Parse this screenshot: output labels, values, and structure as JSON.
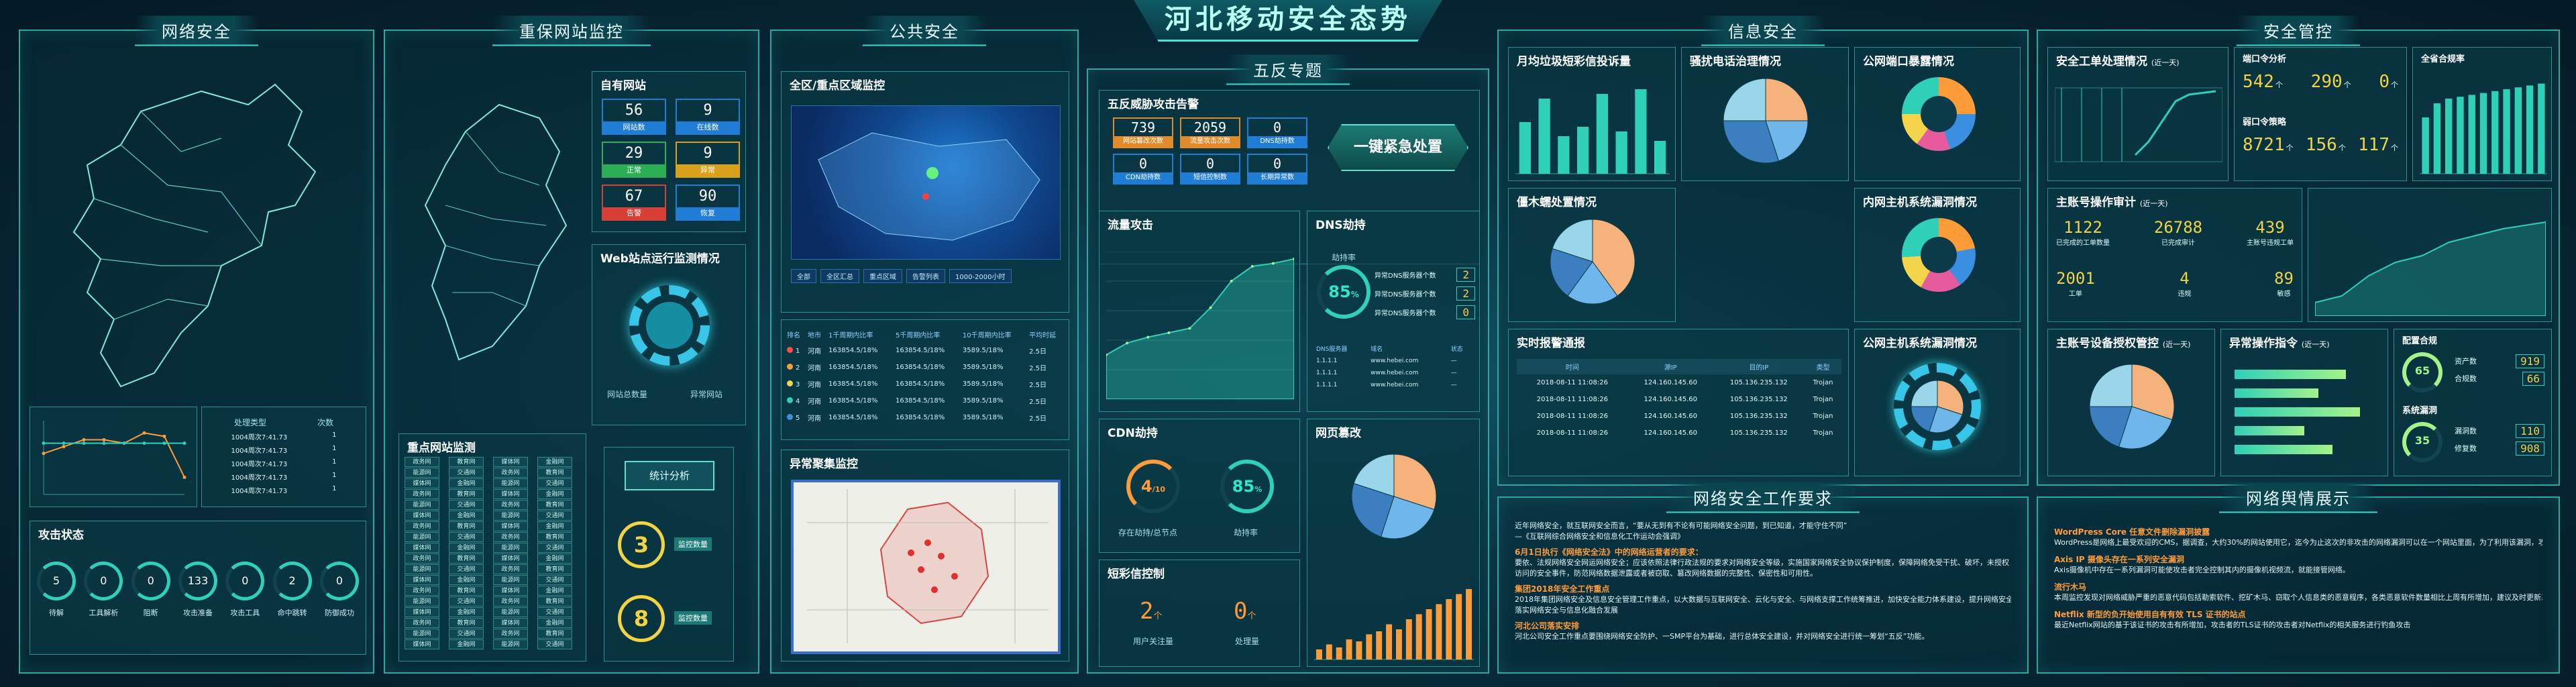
{
  "main_title": "河北移动安全态势",
  "sections": {
    "network_security": "网络安全",
    "key_sites": "重保网站监控",
    "public_security": "公共安全",
    "five_anti": "五反专题",
    "info_security": "信息安全",
    "security_control": "安全管控",
    "work_requirements": "网络安全工作要求",
    "intel_display": "网络舆情展示"
  },
  "attack_status": {
    "title": "攻击状态",
    "items": [
      {
        "value": "5",
        "label": "待解"
      },
      {
        "value": "0",
        "label": "工具解析"
      },
      {
        "value": "0",
        "label": "阻断"
      },
      {
        "value": "133",
        "label": "攻击准备"
      },
      {
        "value": "0",
        "label": "攻击工具"
      },
      {
        "value": "2",
        "label": "命中跳转"
      },
      {
        "value": "0",
        "label": "防御成功"
      }
    ]
  },
  "mini_table": {
    "headers": [
      "处理类型",
      "次数"
    ],
    "rows": [
      [
        "1004周次7:41.73",
        "1"
      ],
      [
        "1004周次7:41.73",
        "1"
      ],
      [
        "1004周次7:41.73",
        "1"
      ],
      [
        "1004周次7:41.73",
        "1"
      ],
      [
        "1004周次7:41.73",
        "1"
      ]
    ]
  },
  "own_sites": {
    "title": "自有网站",
    "cells": [
      {
        "value": "56",
        "label": "网站数",
        "color": "#1f7dd6"
      },
      {
        "value": "9",
        "label": "在线数",
        "color": "#1f7dd6"
      },
      {
        "value": "29",
        "label": "正常",
        "color": "#2cae55"
      },
      {
        "value": "9",
        "label": "异常",
        "color": "#d9a21a"
      },
      {
        "value": "67",
        "label": "告警",
        "color": "#d94035"
      },
      {
        "value": "90",
        "label": "恢复",
        "color": "#1f7dd6"
      }
    ]
  },
  "web_status": {
    "title": "Web站点运行监测情况",
    "labels": [
      "网站总数量",
      "异常网站"
    ]
  },
  "key_site_monitor": {
    "title": "重点网站监测",
    "buttons": [
      "政务网",
      "教育网",
      "媒体网",
      "金融网",
      "能源网",
      "交通网"
    ]
  },
  "side_counters": [
    {
      "value": "3",
      "label": "监控数量"
    },
    {
      "value": "8",
      "label": "监控数量"
    }
  ],
  "side_button": "统计分析",
  "region_monitor": {
    "title": "全区/重点区域监控"
  },
  "region_table": {
    "tabs": [
      "全部",
      "全区汇总",
      "重点区域",
      "告警列表",
      "1000-2000小时"
    ],
    "headers": [
      "排名",
      "地市",
      "1千周期内比率",
      "5千周期内比率",
      "10千周期内比率",
      "平均时延"
    ],
    "rows": [
      [
        "1",
        "河南",
        "163854.5/18%",
        "163854.5/18%",
        "3589.5/18%",
        "2.5日"
      ],
      [
        "2",
        "河南",
        "163854.5/18%",
        "163854.5/18%",
        "3589.5/18%",
        "2.5日"
      ],
      [
        "3",
        "河南",
        "163854.5/18%",
        "163854.5/18%",
        "3589.5/18%",
        "2.5日"
      ],
      [
        "4",
        "河南",
        "163854.5/18%",
        "163854.5/18%",
        "3589.5/18%",
        "2.5日"
      ],
      [
        "5",
        "河南",
        "163854.5/18%",
        "163854.5/18%",
        "3589.5/18%",
        "2.5日"
      ]
    ]
  },
  "crowd_monitor": {
    "title": "异常聚集监控"
  },
  "five_anti_alert": {
    "title": "五反威胁攻击告警",
    "cells": [
      {
        "value": "739",
        "label": "网站篡改次数",
        "color": "#e08a2a"
      },
      {
        "value": "2059",
        "label": "流量攻击次数",
        "color": "#e08a2a"
      },
      {
        "value": "0",
        "label": "DNS劫持数",
        "color": "#1f7dd6"
      },
      {
        "value": "0",
        "label": "CDN劫持数",
        "color": "#1f7dd6"
      },
      {
        "value": "0",
        "label": "短信控制数",
        "color": "#1f7dd6"
      },
      {
        "value": "0",
        "label": "长期异常数",
        "color": "#1f7dd6"
      }
    ]
  },
  "emergency_button": "一键紧急处置",
  "flow_attack": {
    "title": "流量攻击"
  },
  "dns_hijack": {
    "title": "DNS劫持",
    "percent": "85",
    "gauge_label": "劫持率",
    "rows": [
      {
        "label": "异常DNS服务器个数",
        "value": "2"
      },
      {
        "label": "异常DNS服务器个数",
        "value": "2"
      },
      {
        "label": "异常DNS服务器个数",
        "value": "0"
      }
    ],
    "table_headers": [
      "DNS服务器",
      "域名",
      "状态"
    ],
    "table_rows": [
      [
        "1.1.1.1",
        "www.hebei.com",
        "—"
      ],
      [
        "1.1.1.1",
        "www.hebei.com",
        "—"
      ],
      [
        "1.1.1.1",
        "www.hebei.com",
        "—"
      ]
    ]
  },
  "cdn_hijack": {
    "title": "CDN劫持",
    "value1": "4",
    "sub1": "/10",
    "label1": "存在劫持/总节点",
    "value2": "85",
    "sub2": "%",
    "label2": "劫持率"
  },
  "page_tamper": {
    "title": "网页篡改"
  },
  "sms_control": {
    "title": "短彩信控制",
    "value1": "2",
    "unit1": "个",
    "label1": "用户关注量",
    "value2": "0",
    "unit2": "个",
    "label2": "处理量"
  },
  "info_boxes": {
    "monthly": "月均垃圾短彩信投诉量",
    "fraud_call": "骚扰电话治理情况",
    "port_expose": "公网端口暴露情况",
    "trojan": "僵木蠕处置情况",
    "host_vuln_in": "内网主机系统漏洞情况",
    "realtime": "实时报警通报",
    "host_vuln_out": "公网主机系统漏洞情况"
  },
  "realtime_table": {
    "headers": [
      "时间",
      "源IP",
      "目的IP",
      "类型"
    ],
    "rows": [
      [
        "2018-08-11 11:08:26",
        "124.160.145.60",
        "105.136.235.132",
        "Trojan"
      ],
      [
        "2018-08-11 11:08:26",
        "124.160.145.60",
        "105.136.235.132",
        "Trojan"
      ],
      [
        "2018-08-11 11:08:26",
        "124.160.145.60",
        "105.136.235.132",
        "Trojan"
      ],
      [
        "2018-08-11 11:08:26",
        "124.160.145.60",
        "105.136.235.132",
        "Trojan"
      ]
    ]
  },
  "control": {
    "workorder": "安全工单处理情况",
    "workorder_unit": "(近一天)",
    "port_scan": "端口令分析",
    "port_values": [
      {
        "value": "542",
        "unit": "个"
      },
      {
        "value": "290",
        "unit": "个"
      },
      {
        "value": "0",
        "unit": "个"
      }
    ],
    "weak_pwd": "弱口令策略",
    "weak_values": [
      {
        "value": "8721",
        "unit": "个"
      },
      {
        "value": "156",
        "unit": "个"
      },
      {
        "value": "117",
        "unit": "个"
      }
    ],
    "compliance": "全省合规率",
    "audit": "主账号操作审计",
    "audit_unit": "(近一天)",
    "audit_row1": [
      {
        "value": "1122",
        "label": "已完成的工单数量"
      },
      {
        "value": "26788",
        "label": "已完成审计"
      },
      {
        "value": "439",
        "label": "主账号违规工单"
      }
    ],
    "audit_row2": [
      {
        "value": "2001",
        "label": "工单"
      },
      {
        "value": "4",
        "label": "违规"
      },
      {
        "value": "89",
        "label": "敏感"
      }
    ],
    "authorize": "主账号设备授权管控",
    "authorize_unit": "(近一天)",
    "abnormal": "异常操作指令",
    "abnormal_unit": "(近一天)",
    "config": "配置合规",
    "config_rows": [
      {
        "label": "资产数",
        "value": "919"
      },
      {
        "label": "合规数",
        "value": "66"
      }
    ],
    "vuln": "系统漏洞",
    "vuln_rows": [
      {
        "label": "漏洞数",
        "value": "110"
      },
      {
        "label": "修复数",
        "value": "908"
      }
    ],
    "config_percent": "65",
    "vuln_percent": "35"
  },
  "work_req": [
    {
      "h": "",
      "t": "近年网络安全，就互联网安全而言，“要从无到有不论有可能网络安全问题，到已知道，才能守住不同”"
    },
    {
      "h": "",
      "t": "—《互联网综合网络安全和信息化工作运动会强调》"
    },
    {
      "h": "6月1日执行《网络安全法》中的网络运营者的要求：",
      "t": ""
    },
    {
      "h": "",
      "t": "要依、法规网络安全网运网络安全；应该依照法律行政法规的要求对网络安全等级，实施国家网络安全协议保护制度，保障网络免受干扰、破坏，未授权"
    },
    {
      "h": "",
      "t": "访问的安全事件，防范网络数据泄露或者被窃取、篡改网络数据的完整性、保密性和可用性。"
    },
    {
      "h": "集团2018年安全工作重点",
      "t": ""
    },
    {
      "h": "",
      "t": "2018年集团网络安全及信息安全管理工作重点，以大数据与互联网安全、云化与安全、与网络支撑工作统筹推进，加快安全能力体系建设，提升网络安全防护能力和水平"
    },
    {
      "h": "",
      "t": "落实网络安全与信息化融合发展"
    },
    {
      "h": "河北公司落实安排",
      "t": ""
    },
    {
      "h": "",
      "t": "河北公司安全工作重点要围绕网络安全防护、一SMP平台为基础，进行总体安全建设，并对网络安全进行统一筹划“五反”功能。"
    }
  ],
  "intel": [
    {
      "h": "WordPress Core 任意文件删除漏洞披露",
      "t": "WordPress是网络上最受欢迎的CMS，据调查，大约30%的网站使用它，迄今为止这次的非攻击的网络漏洞可以在一个网站里面，为了利用该漏洞，攻击者需要获得作者的权限"
    },
    {
      "h": "Axis IP 摄像头存在一系列安全漏洞",
      "t": "Axis摄像机中存在一系列漏洞可能使攻击者完全控制其内的摄像机视频流，就能接管网络。"
    },
    {
      "h": "流行木马",
      "t": "本周监控发现对网络威胁严重的恶意代码包括勒索软件、挖矿木马、窃取个人信息类的恶意程序，各类恶意软件数量相比上周有所增加，建议及时更新系统补丁。"
    },
    {
      "h": "Netflix 新型的负开始使用自有有效 TLS 证书的站点",
      "t": "最近Netflix网站的基于该证书的攻击有所增加，攻击者的TLS证书的攻击者对Netflix的相关服务进行钓鱼攻击"
    }
  ],
  "chart_data": [
    {
      "type": "line",
      "title": "",
      "x": [
        "1",
        "2",
        "3",
        "4",
        "5",
        "6",
        "7",
        "8"
      ],
      "series": [
        {
          "name": "",
          "values": [
            12,
            14,
            16,
            16,
            15,
            18,
            17,
            5
          ]
        },
        {
          "name": "",
          "values": [
            15,
            15,
            15,
            15,
            15,
            15,
            15,
            15
          ]
        }
      ]
    },
    {
      "type": "area",
      "title": "流量攻击",
      "x": [
        "1",
        "2",
        "3",
        "4",
        "5",
        "6",
        "7",
        "8",
        "9",
        "10"
      ],
      "series": [
        {
          "name": "",
          "values": [
            30,
            38,
            42,
            45,
            48,
            62,
            80,
            90,
            92,
            95
          ]
        }
      ]
    },
    {
      "type": "bar",
      "title": "网页篡改",
      "x": [
        "1",
        "2",
        "3",
        "4",
        "5",
        "6",
        "7",
        "8",
        "9",
        "10",
        "11",
        "12",
        "13",
        "14",
        "15",
        "16"
      ],
      "values": [
        10,
        15,
        12,
        20,
        18,
        25,
        28,
        35,
        30,
        40,
        45,
        50,
        55,
        60,
        65,
        70
      ]
    },
    {
      "type": "bar",
      "title": "月均垃圾短彩信投诉量",
      "x": [
        "1",
        "2",
        "3",
        "4",
        "5",
        "6",
        "7",
        "8"
      ],
      "values": [
        55,
        80,
        40,
        50,
        85,
        45,
        90,
        35
      ]
    },
    {
      "type": "pie",
      "title": "骚扰电话治理情况",
      "values": [
        25,
        20,
        30,
        25
      ]
    },
    {
      "type": "pie",
      "title": "僵木蠕处置情况",
      "values": [
        40,
        20,
        20,
        20
      ]
    },
    {
      "type": "pie",
      "title": "网页篡改",
      "values": [
        30,
        25,
        25,
        20
      ]
    },
    {
      "type": "pie",
      "title": "主账号设备授权管控",
      "values": [
        30,
        25,
        20,
        25
      ]
    },
    {
      "type": "bar",
      "title": "全省合规率",
      "x": [
        "1",
        "2",
        "3",
        "4",
        "5",
        "6",
        "7",
        "8",
        "9",
        "10",
        "11"
      ],
      "values": [
        60,
        75,
        80,
        82,
        84,
        86,
        88,
        90,
        92,
        94,
        96
      ]
    }
  ],
  "colors": {
    "accent": "#3ed6c6",
    "orange": "#ff9c3a",
    "blue": "#3a8fe0",
    "pie": [
      "#f6b27b",
      "#6fb7ea",
      "#3b7fc1",
      "#9ad6e9"
    ]
  }
}
